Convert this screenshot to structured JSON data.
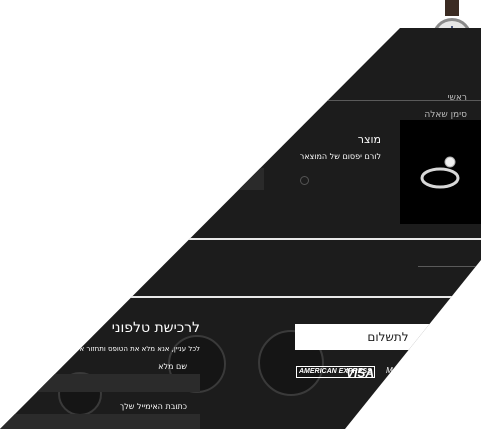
{
  "menu": {
    "items": [
      "ראשי",
      "סימן שאלה"
    ]
  },
  "product": {
    "title": "מוצר",
    "description": "לורם יפסום של המוצאר"
  },
  "phone_order": {
    "title": "לרכישת טלפוני",
    "subtitle": "לכל עניין, אנא מלא את הטופס ותחזור אליך."
  },
  "form": {
    "name_label": "שם מלא",
    "email_label": "כתובת האימייל שלך"
  },
  "payment": {
    "button_label": "לתשלום",
    "logos": [
      "AMERICAN EXPRESS",
      "VISA",
      "MasterCard"
    ]
  },
  "colors": {
    "background": "#1c1c1c",
    "text": "#ffffff",
    "accent": "#ffffff"
  }
}
